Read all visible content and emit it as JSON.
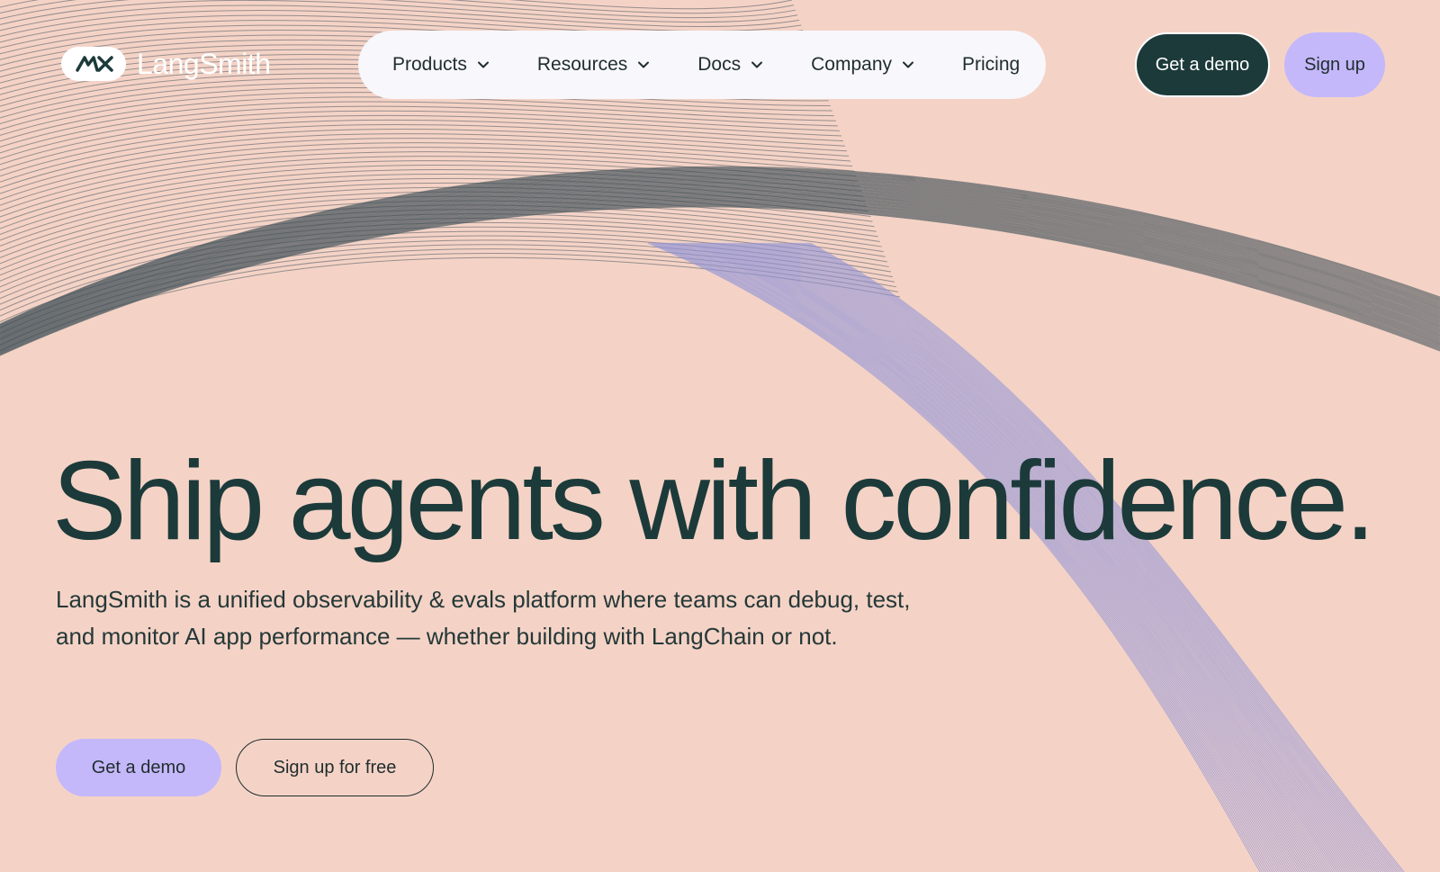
{
  "brand": {
    "name": "LangSmith",
    "logo_icon": "langsmith-logo-icon"
  },
  "nav": {
    "items": [
      {
        "label": "Products",
        "has_dropdown": true
      },
      {
        "label": "Resources",
        "has_dropdown": true
      },
      {
        "label": "Docs",
        "has_dropdown": true
      },
      {
        "label": "Company",
        "has_dropdown": true
      },
      {
        "label": "Pricing",
        "has_dropdown": false
      }
    ],
    "get_demo_label": "Get a demo",
    "sign_up_label": "Sign up"
  },
  "hero": {
    "headline": "Ship agents with confidence.",
    "subheadline": "LangSmith is a unified observability & evals platform where teams can debug, test, and monitor AI app performance — whether building with LangChain or not.",
    "primary_cta": "Get a demo",
    "secondary_cta": "Sign up for free"
  },
  "colors": {
    "background": "#f4d3c6",
    "dark_green": "#1d3a3a",
    "lavender": "#c4b8fb",
    "nav_pill": "#f8f7fb"
  }
}
